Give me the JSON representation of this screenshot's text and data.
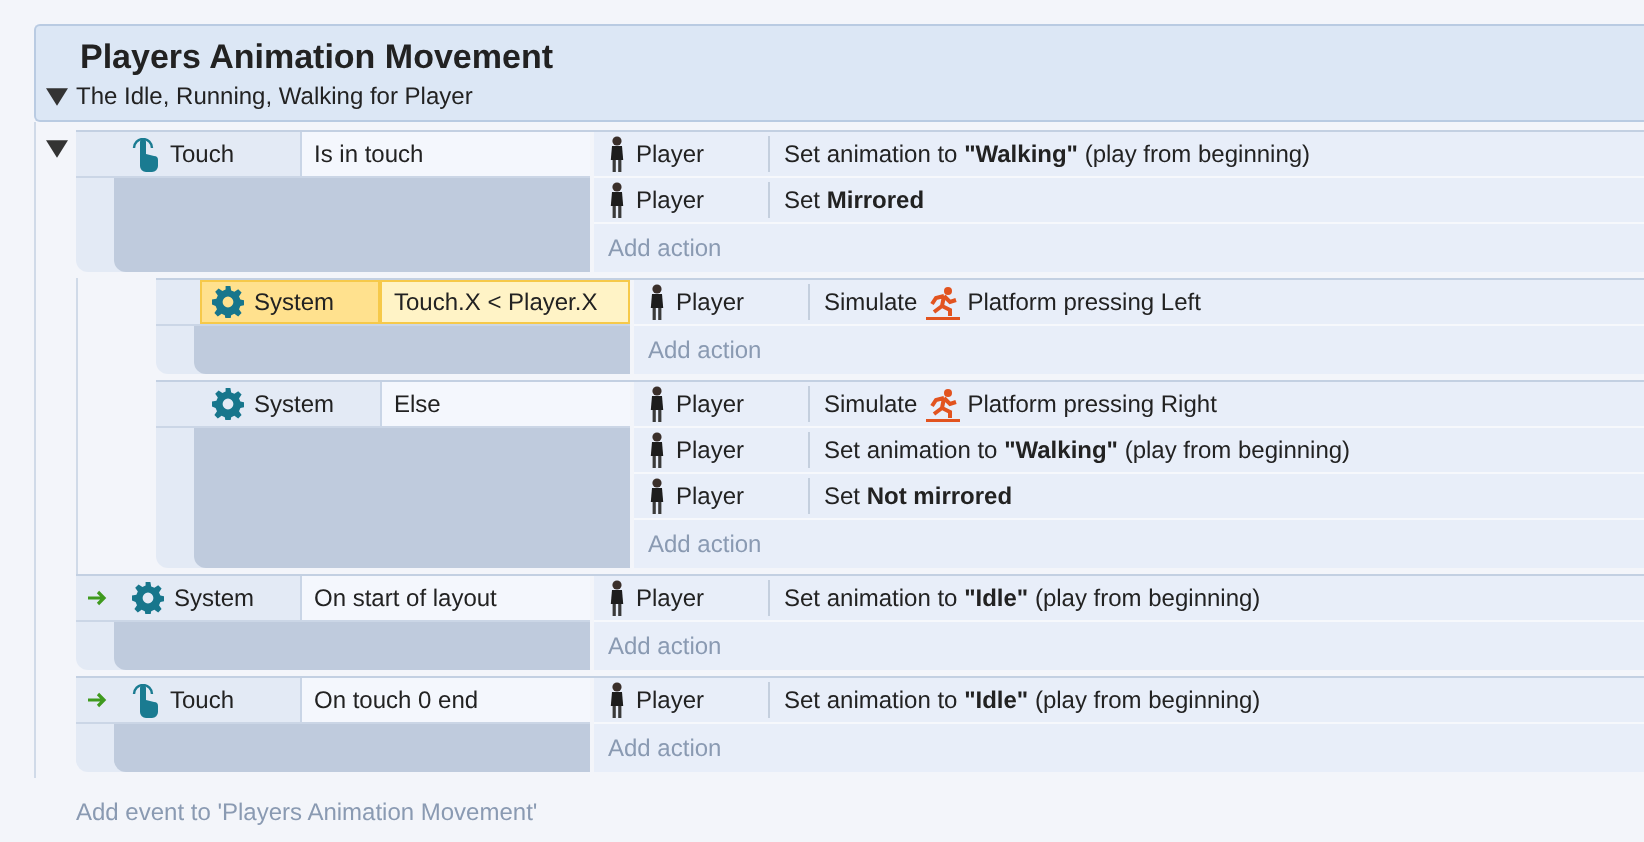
{
  "group": {
    "title": "Players Animation Movement",
    "description": "The Idle, Running, Walking for Player",
    "expanded": true
  },
  "events": [
    {
      "expanded": true,
      "trigger": false,
      "conditions": [
        {
          "kind": "touch",
          "object": "Touch",
          "text": "Is in touch",
          "selected": false
        }
      ],
      "actions": [
        {
          "object": "Player",
          "text": "Set animation to **\"Walking\"** (play from beginning)"
        },
        {
          "object": "Player",
          "text": "Set **Mirrored**"
        }
      ],
      "add_action": "Add action",
      "children": [
        {
          "trigger": false,
          "conditions": [
            {
              "kind": "system",
              "object": "System",
              "text": "Touch.X < Player.X",
              "selected": true
            }
          ],
          "actions": [
            {
              "object": "Player",
              "text": "Simulate",
              "behavior": "Platform pressing Left"
            }
          ],
          "add_action": "Add action"
        },
        {
          "trigger": false,
          "conditions": [
            {
              "kind": "system",
              "object": "System",
              "text": "Else",
              "selected": false
            }
          ],
          "actions": [
            {
              "object": "Player",
              "text": "Simulate",
              "behavior": "Platform pressing Right"
            },
            {
              "object": "Player",
              "text": "Set animation to **\"Walking\"** (play from beginning)"
            },
            {
              "object": "Player",
              "text": "Set **Not mirrored**"
            }
          ],
          "add_action": "Add action"
        }
      ]
    },
    {
      "trigger": true,
      "conditions": [
        {
          "kind": "system",
          "object": "System",
          "text": "On start of layout",
          "selected": false
        }
      ],
      "actions": [
        {
          "object": "Player",
          "text": "Set animation to **\"Idle\"** (play from beginning)"
        }
      ],
      "add_action": "Add action"
    },
    {
      "trigger": true,
      "conditions": [
        {
          "kind": "touch",
          "object": "Touch",
          "text": "On touch 0 end",
          "selected": false
        }
      ],
      "actions": [
        {
          "object": "Player",
          "text": "Set animation to **\"Idle\"** (play from beginning)"
        }
      ],
      "add_action": "Add action"
    }
  ],
  "add_event": "Add event to 'Players Animation Movement'"
}
